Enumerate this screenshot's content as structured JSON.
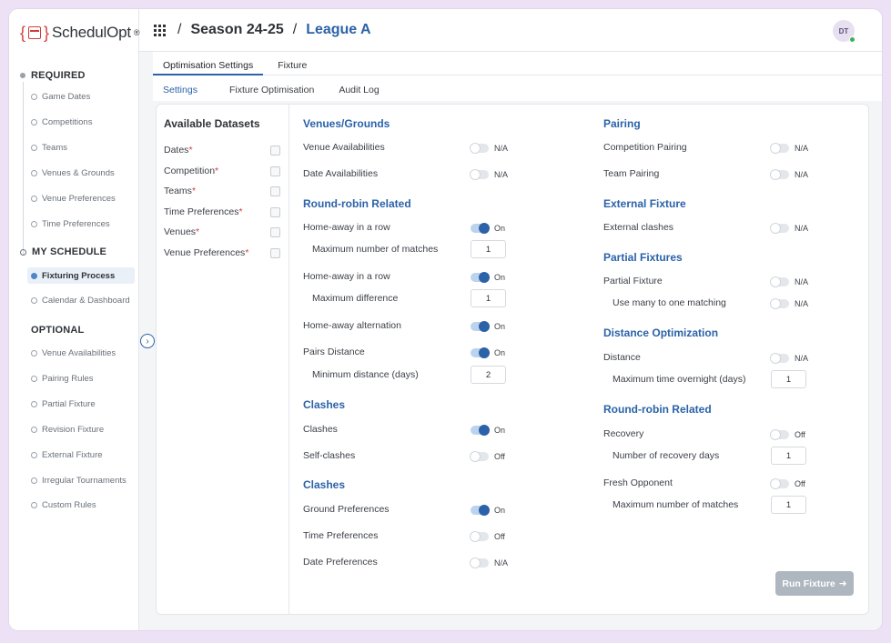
{
  "brand": {
    "name": "SchedulOpt",
    "reg": "®"
  },
  "sidebar": {
    "required_label": "REQUIRED",
    "required_items": [
      "Game Dates",
      "Competitions",
      "Teams",
      "Venues & Grounds",
      "Venue Preferences",
      "Time Preferences"
    ],
    "my_schedule_label": "MY SCHEDULE",
    "my_schedule_items": [
      "Fixturing Process",
      "Calendar & Dashboard"
    ],
    "optional_label": "OPTIONAL",
    "optional_items": [
      "Venue Availabilities",
      "Pairing Rules",
      "Partial Fixture",
      "Revision Fixture",
      "External Fixture",
      "Irregular Tournaments",
      "Custom Rules"
    ]
  },
  "header": {
    "crumb1": "Season 24-25",
    "crumb2": "League A",
    "separator": "/",
    "avatar": "DT"
  },
  "tabs": [
    "Optimisation Settings",
    "Fixture"
  ],
  "subtabs": [
    "Settings",
    "Fixture Optimisation",
    "Audit Log"
  ],
  "datasets": {
    "title": "Available Datasets",
    "items": [
      "Dates",
      "Competition",
      "Teams",
      "Time Preferences",
      "Venues",
      "Venue Preferences"
    ],
    "required_mark": "*"
  },
  "col1": {
    "venues_title": "Venues/Grounds",
    "venue_avail": {
      "label": "Venue Availabilities",
      "state": "N/A"
    },
    "date_avail": {
      "label": "Date Availabilities",
      "state": "N/A"
    },
    "rr_title": "Round-robin Related",
    "ha_row1": {
      "label": "Home-away in a row",
      "state": "On"
    },
    "max_matches": {
      "label": "Maximum number of matches",
      "value": "1"
    },
    "ha_row2": {
      "label": "Home-away in a row",
      "state": "On"
    },
    "max_diff": {
      "label": "Maximum difference",
      "value": "1"
    },
    "ha_alt": {
      "label": "Home-away alternation",
      "state": "On"
    },
    "pairs_dist": {
      "label": "Pairs Distance",
      "state": "On"
    },
    "min_dist": {
      "label": "Minimum distance (days)",
      "value": "2"
    },
    "clashes_title": "Clashes",
    "clashes": {
      "label": "Clashes",
      "state": "On"
    },
    "self_clashes": {
      "label": "Self-clashes",
      "state": "Off"
    },
    "clashes2_title": "Clashes",
    "ground_pref": {
      "label": "Ground Preferences",
      "state": "On"
    },
    "time_pref": {
      "label": "Time Preferences",
      "state": "Off"
    },
    "date_pref": {
      "label": "Date Preferences",
      "state": "N/A"
    }
  },
  "col2": {
    "pairing_title": "Pairing",
    "comp_pairing": {
      "label": "Competition Pairing",
      "state": "N/A"
    },
    "team_pairing": {
      "label": "Team Pairing",
      "state": "N/A"
    },
    "ext_title": "External Fixture",
    "ext_clashes": {
      "label": "External clashes",
      "state": "N/A"
    },
    "partial_title": "Partial Fixtures",
    "partial": {
      "label": "Partial Fixture",
      "state": "N/A"
    },
    "many_to_one": {
      "label": "Use many to one matching",
      "state": "N/A"
    },
    "dist_title": "Distance Optimization",
    "distance": {
      "label": "Distance",
      "state": "N/A"
    },
    "max_overnight": {
      "label": "Maximum time overnight (days)",
      "value": "1"
    },
    "rr_title": "Round-robin Related",
    "recovery": {
      "label": "Recovery",
      "state": "Off"
    },
    "recovery_days": {
      "label": "Number of recovery days",
      "value": "1"
    },
    "fresh": {
      "label": "Fresh Opponent",
      "state": "Off"
    },
    "fresh_max": {
      "label": "Maximum number of matches",
      "value": "1"
    }
  },
  "run_button": "Run Fixture",
  "colors": {
    "accent": "#2b62a8",
    "required": "#d23c3c",
    "frame_bg": "#ede2f5"
  }
}
